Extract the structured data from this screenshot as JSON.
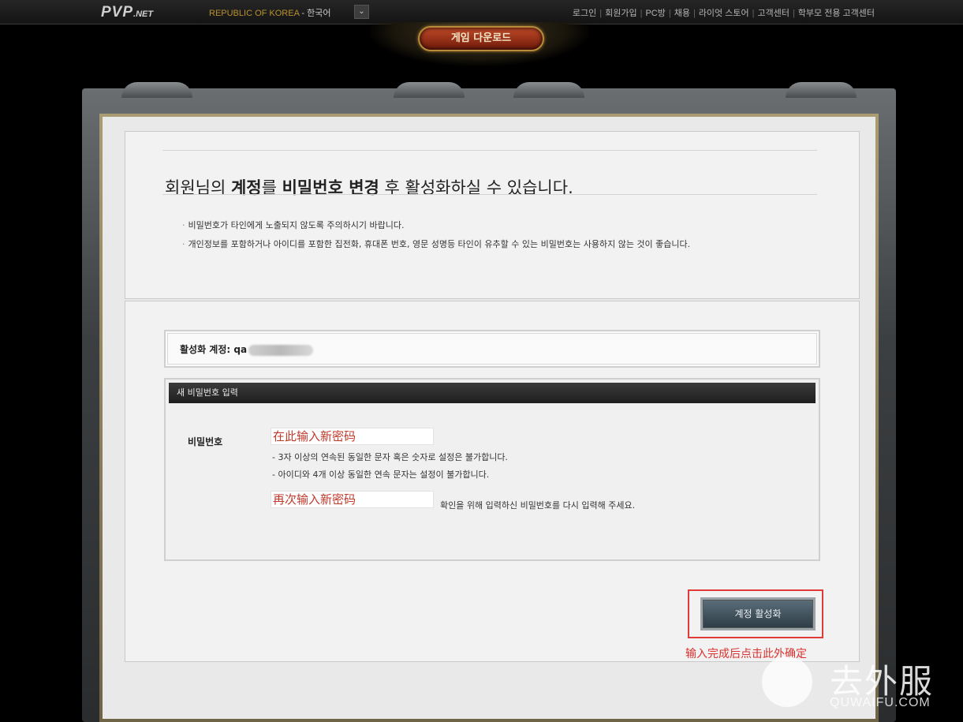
{
  "topbar": {
    "logo": "PVP",
    "logo_suffix": ".NET",
    "region": "REPUBLIC OF KOREA",
    "region_sep": " - ",
    "language": "한국어",
    "nav": [
      "로그인",
      "회원가입",
      "PC방",
      "채용",
      "라이엇 스토어",
      "고객센터",
      "학부모 전용 고객센터"
    ]
  },
  "download_button": "게임 다운로드",
  "headline": {
    "part1": "회원님의 ",
    "bold1": "계정",
    "part2": "를 ",
    "bold2": "비밀번호 변경",
    "part3": " 후 활성화하실 수 있습니다."
  },
  "notes": [
    "비밀번호가 타인에게 노출되지 않도록 주의하시기 바랍니다.",
    "개인정보를 포함하거나 아이디를 포함한 집전화, 휴대폰 번호, 영문 성명등 타인이 유추할 수 있는 비밀번호는 사용하지 않는 것이 좋습니다."
  ],
  "account": {
    "label": "활성화 계정:",
    "value_visible": "qa"
  },
  "password_section": {
    "header": "새 비밀번호 입력",
    "label": "비밀번호",
    "new_placeholder": "在此输入新密码",
    "rules": [
      "- 3자 이상의 연속된 동일한 문자 혹은 숫자로 설정은 불가합니다.",
      "- 아이디와 4개 이상 동일한 연속 문자는 설정이 불가합니다."
    ],
    "confirm_placeholder": "再次输入新密码",
    "confirm_hint": "확인을 위해 입력하신 비밀번호를 다시 입력해 주세요."
  },
  "activate_button": "계정 활성화",
  "annotation": "输入完成后点击此外确定",
  "watermark": {
    "title": "去外服",
    "url": "QUWAIFU.COM"
  },
  "colors": {
    "annotation_red": "#d9322f",
    "region_gold": "#b8902e"
  }
}
